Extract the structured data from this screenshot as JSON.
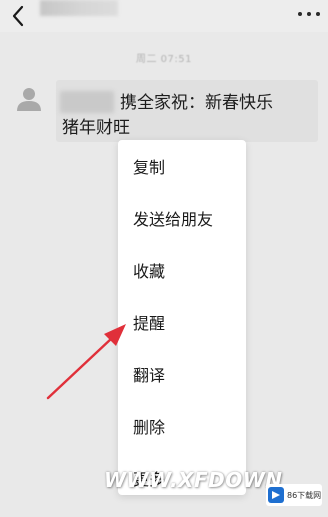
{
  "header": {
    "back_icon": "chevron-left-icon",
    "more_icon": "more-dots-icon"
  },
  "timestamp": "周二 07:51",
  "message": {
    "line1": "携全家祝：新春快乐",
    "line2": "猪年财旺"
  },
  "context_menu": {
    "items": [
      {
        "label": "复制"
      },
      {
        "label": "发送给朋友"
      },
      {
        "label": "收藏"
      },
      {
        "label": "提醒"
      },
      {
        "label": "翻译"
      },
      {
        "label": "删除"
      },
      {
        "label": "更多"
      }
    ]
  },
  "annotation": {
    "arrow_color": "#e0303a"
  },
  "watermark": {
    "text": "WWW.XFDOWN",
    "badge_label": "86下载网"
  }
}
